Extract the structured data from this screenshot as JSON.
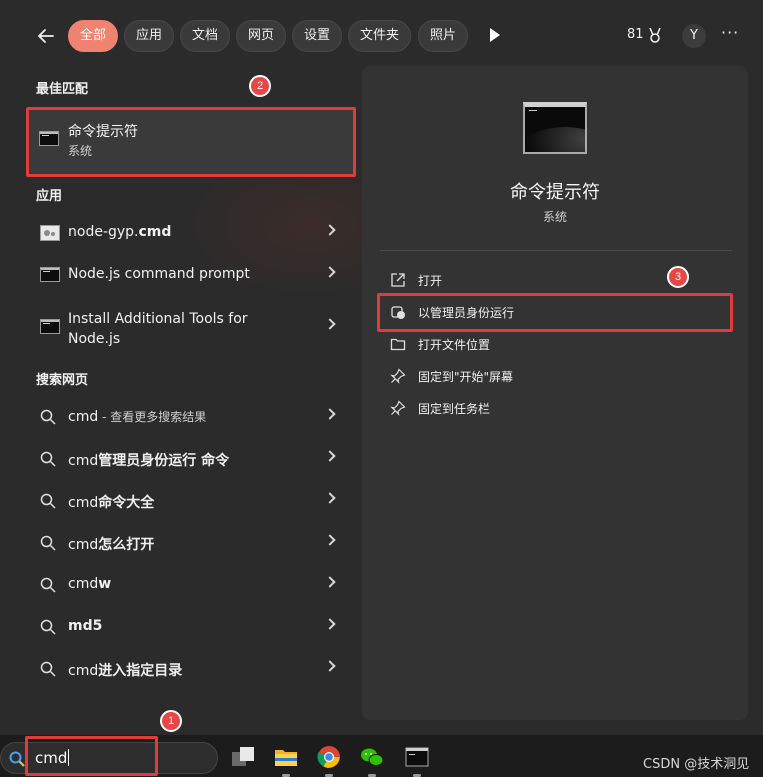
{
  "topbar": {
    "tabs": [
      "全部",
      "应用",
      "文档",
      "网页",
      "设置",
      "文件夹",
      "照片"
    ],
    "points": "81",
    "avatar": "Y",
    "more": "···"
  },
  "left": {
    "best_match_title": "最佳匹配",
    "best_match": {
      "title": "命令提示符",
      "subtitle": "系统"
    },
    "apps_title": "应用",
    "apps": [
      {
        "pre": "node-gyp.",
        "bold": "cmd"
      },
      {
        "label": "Node.js command prompt"
      },
      {
        "label": "Install Additional Tools for Node.js"
      }
    ],
    "web_title": "搜索网页",
    "web": [
      {
        "q": "cmd",
        "sub": " - 查看更多搜索结果"
      },
      {
        "q": "cmd",
        "bold": "管理员身份运行 命令"
      },
      {
        "q": "cmd",
        "bold": "命令大全"
      },
      {
        "q": "cmd",
        "bold": "怎么打开"
      },
      {
        "q": "cmd",
        "bold": "w"
      },
      {
        "q": "",
        "bold": "md5"
      },
      {
        "q": "cmd",
        "bold": "进入指定目录"
      }
    ]
  },
  "right": {
    "title": "命令提示符",
    "subtitle": "系统",
    "actions": [
      "打开",
      "以管理员身份运行",
      "打开文件位置",
      "固定到\"开始\"屏幕",
      "固定到任务栏"
    ]
  },
  "annotations": [
    "1",
    "2",
    "3"
  ],
  "taskbar": {
    "search_value": "cmd",
    "watermark": "CSDN @技术洞见"
  },
  "colors": {
    "accent": "#f0836f",
    "annotation_red": "#e03c3c",
    "panel": "#2b2b2b",
    "pane": "#333333"
  }
}
